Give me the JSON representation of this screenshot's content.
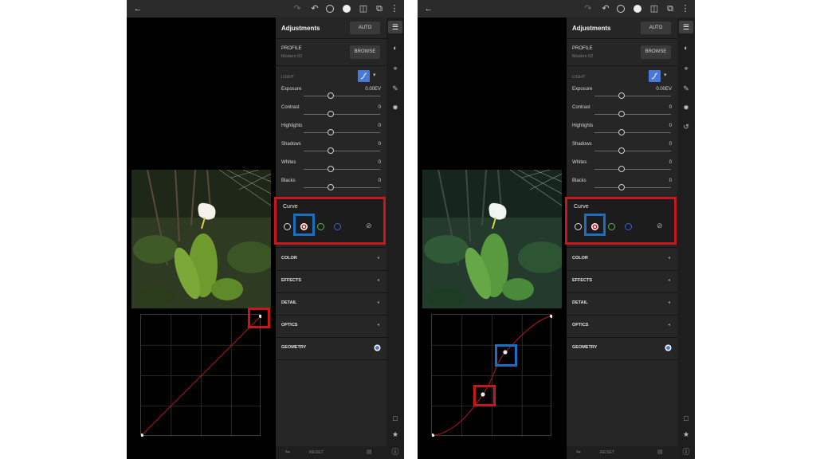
{
  "panel": {
    "title": "Adjustments",
    "auto_label": "AUTO",
    "profile_label": "PROFILE",
    "profile_value": "Modern 02",
    "browse_label": "BROWSE",
    "light_label": "LIGHT",
    "sliders": [
      {
        "name": "Exposure",
        "value": "0.00EV"
      },
      {
        "name": "Contrast",
        "value": "0"
      },
      {
        "name": "Highlights",
        "value": "0"
      },
      {
        "name": "Shadows",
        "value": "0"
      },
      {
        "name": "Whites",
        "value": "0"
      },
      {
        "name": "Blacks",
        "value": "0"
      }
    ],
    "curve_label": "Curve",
    "sections": [
      "COLOR",
      "EFFECTS",
      "DETAIL",
      "OPTICS",
      "GEOMETRY"
    ],
    "reset_label": "RESET"
  },
  "icons": {
    "top": [
      "back-arrow-icon",
      "redo-icon",
      "undo-icon",
      "help-icon",
      "done-check-icon",
      "compare-icon",
      "share-icon",
      "more-icon"
    ],
    "tools": [
      "edit-sliders-icon",
      "presets-icon",
      "crop-icon",
      "healing-icon",
      "masking-icon",
      "versions-icon",
      "comment-icon",
      "star-icon",
      "info-icon"
    ]
  },
  "colors": {
    "highlight_red": "#c8171b",
    "highlight_blue": "#1b6fc2",
    "accent_blue": "#4a78d8",
    "curve_red": "#c8171b"
  },
  "states": {
    "left": {
      "curve_shape": "linear"
    },
    "right": {
      "curve_shape": "s-curve"
    }
  }
}
